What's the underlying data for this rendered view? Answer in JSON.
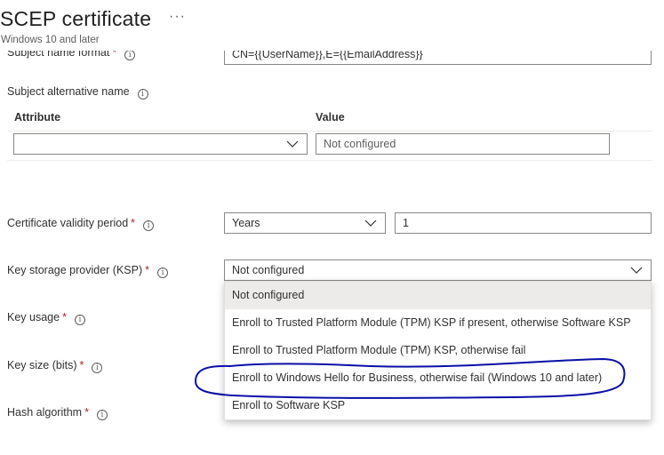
{
  "header": {
    "title": "SCEP certificate",
    "more_label": "···",
    "subtitle": "Windows 10 and later"
  },
  "subject_name_format": {
    "label": "Subject name format",
    "required": "*",
    "value": "CN={{UserName}},E={{EmailAddress}}"
  },
  "san": {
    "label": "Subject alternative name",
    "col_attribute": "Attribute",
    "col_value": "Value",
    "attribute_value": "",
    "value_placeholder": "Not configured"
  },
  "validity": {
    "label": "Certificate validity period",
    "required": "*",
    "unit": "Years",
    "amount": "1"
  },
  "ksp": {
    "label": "Key storage provider (KSP)",
    "required": "*",
    "selected": "Not configured",
    "options": [
      "Not configured",
      "Enroll to Trusted Platform Module (TPM) KSP if present, otherwise Software KSP",
      "Enroll to Trusted Platform Module (TPM) KSP, otherwise fail",
      "Enroll to Windows Hello for Business, otherwise fail (Windows 10 and later)",
      "Enroll to Software KSP"
    ]
  },
  "key_usage": {
    "label": "Key usage",
    "required": "*"
  },
  "key_size": {
    "label": "Key size (bits)",
    "required": "*"
  },
  "hash_algorithm": {
    "label": "Hash algorithm",
    "required": "*"
  },
  "info_glyph": "i",
  "colors": {
    "required": "#a4262c",
    "border": "#8a8886",
    "selected_option": "#edebe9",
    "annotation": "#0a0fa8"
  }
}
